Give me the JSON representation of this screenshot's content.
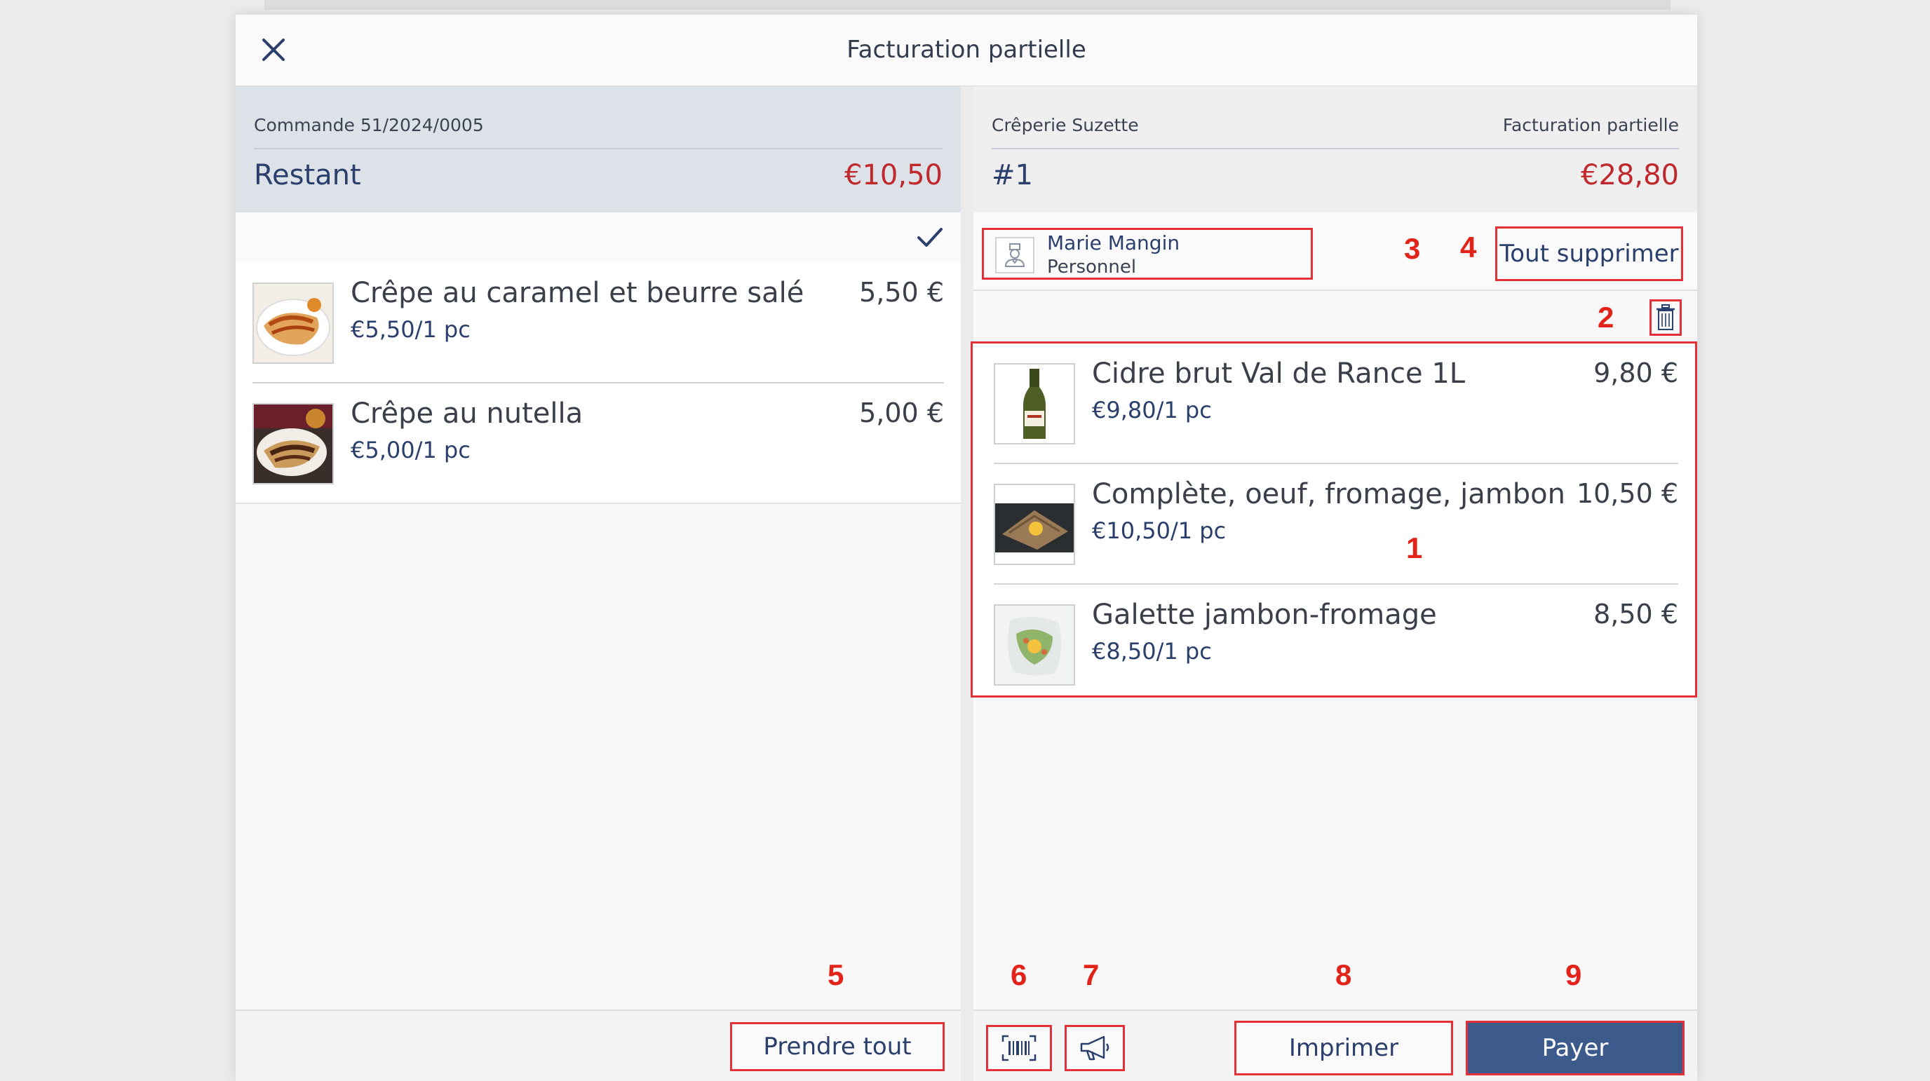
{
  "dialog": {
    "title": "Facturation partielle"
  },
  "left": {
    "order_label": "Commande 51/2024/0005",
    "remaining_label": "Restant",
    "remaining_amount": "€10,50",
    "items": [
      {
        "name": "Crêpe au caramel et beurre salé",
        "unit": "€5,50/1 pc",
        "price": "5,50 €",
        "image": "crepe-caramel-photo"
      },
      {
        "name": "Crêpe au nutella",
        "unit": "€5,00/1 pc",
        "price": "5,00 €",
        "image": "crepe-nutella-photo"
      }
    ],
    "take_all_label": "Prendre tout"
  },
  "right": {
    "restaurant": "Crêperie Suzette",
    "mode_label": "Facturation partielle",
    "bill_number": "#1",
    "bill_amount": "€28,80",
    "staff_name": "Marie Mangin",
    "staff_role": "Personnel",
    "delete_all_label": "Tout supprimer",
    "items": [
      {
        "name": "Cidre brut Val de Rance 1L",
        "unit": "€9,80/1 pc",
        "price": "9,80 €",
        "image": "cider-bottle-photo"
      },
      {
        "name": "Complète, oeuf, fromage, jambon",
        "unit": "€10,50/1 pc",
        "price": "10,50 €",
        "image": "galette-complete-photo"
      },
      {
        "name": "Galette jambon-fromage",
        "unit": "€8,50/1 pc",
        "price": "8,50 €",
        "image": "galette-jambon-photo"
      }
    ],
    "print_label": "Imprimer",
    "pay_label": "Payer"
  },
  "annotations": [
    "1",
    "2",
    "3",
    "4",
    "5",
    "6",
    "7",
    "8",
    "9"
  ],
  "icons": {
    "close": "close-icon",
    "check": "checkmark-icon",
    "trash": "trash-icon",
    "staff": "waiter-avatar-icon",
    "barcode": "barcode-scanner-icon",
    "megaphone": "megaphone-icon"
  },
  "colors": {
    "accent_blue": "#3d5a8c",
    "amount_red": "#c0282d",
    "annotation_red": "#e2231a"
  }
}
